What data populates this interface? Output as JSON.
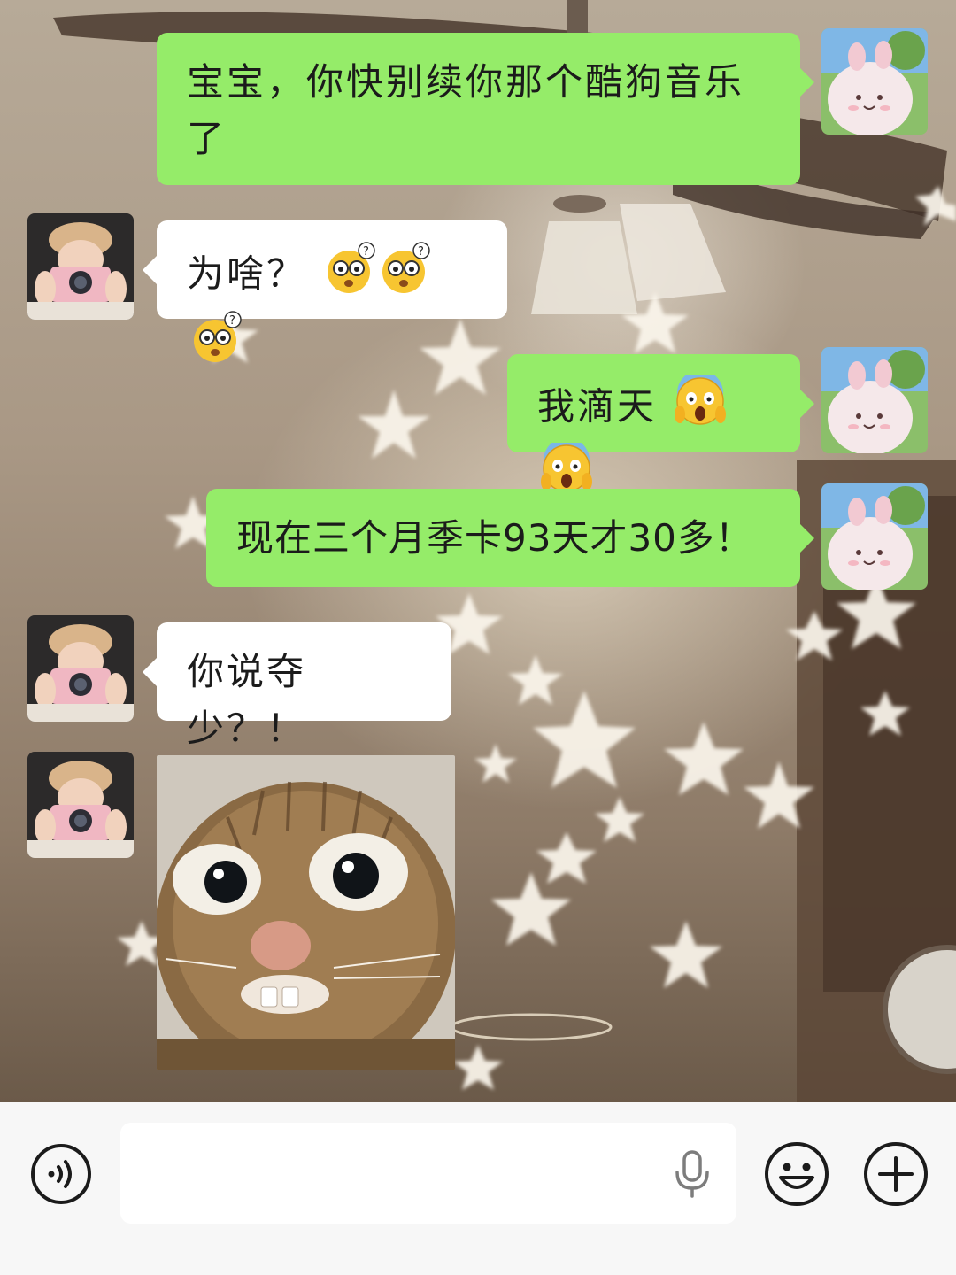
{
  "messages": [
    {
      "sender": "me",
      "text": "宝宝，你快别续你那个酷狗音乐了"
    },
    {
      "sender": "other",
      "text": "为啥？",
      "emoji": [
        "confused-face",
        "confused-face",
        "confused-face"
      ]
    },
    {
      "sender": "me",
      "text": "我滴天",
      "emoji": [
        "screaming-face",
        "screaming-face"
      ]
    },
    {
      "sender": "me",
      "text": "现在三个月季卡93天才30多！"
    },
    {
      "sender": "other",
      "text": "你说夺少？！"
    },
    {
      "sender": "other",
      "sticker": "shocked-cat-sticker"
    }
  ],
  "input": {
    "placeholder": "",
    "value": ""
  },
  "icons": {
    "voice": "voice-mode-icon",
    "mic": "microphone-icon",
    "emoji": "emoji-icon",
    "plus": "plus-icon"
  },
  "colors": {
    "my_bubble": "#95ec69",
    "their_bubble": "#ffffff",
    "input_bar": "#f7f7f7"
  }
}
